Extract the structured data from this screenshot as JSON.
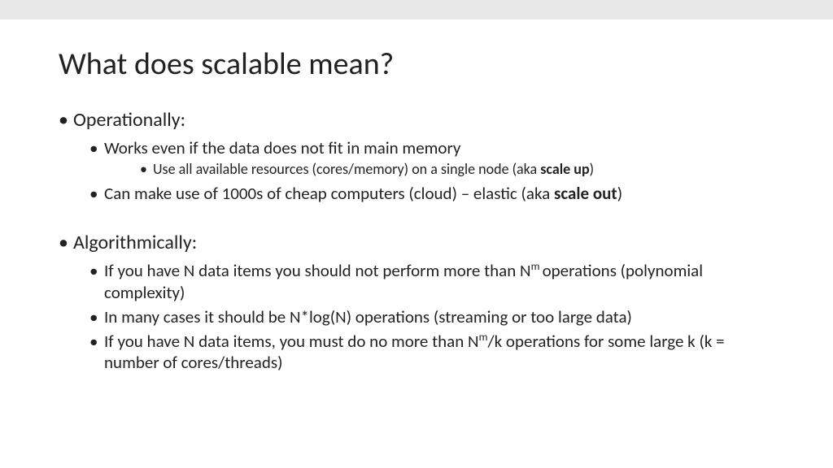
{
  "title": "What does scalable mean?",
  "section1": {
    "heading": "Operationally:",
    "b1": "Works even if the data does not fit in main memory",
    "b1a_pre": "Use all available resources (cores/memory) on a single node (aka ",
    "b1a_bold": "scale up",
    "b1a_post": ")",
    "b2_pre": "Can make use of 1000s of cheap computers (cloud) – elastic (aka ",
    "b2_bold": "scale out",
    "b2_post": ")"
  },
  "section2": {
    "heading": "Algorithmically:",
    "b1_pre": "If you have N data items you should not perform more than N",
    "b1_sup": "m ",
    "b1_post": "operations (polynomial complexity)",
    "b2": "In many cases it should be N*log(N) operations (streaming or too large data)",
    "b3_pre": "If you have N data items, you must do no more than N",
    "b3_sup": "m",
    "b3_post": "/k operations for some large k (k = number of cores/threads)"
  }
}
